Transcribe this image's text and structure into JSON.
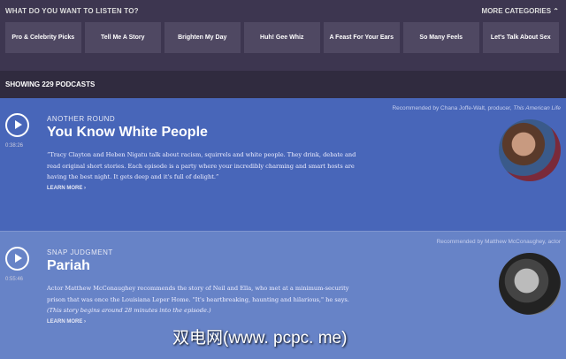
{
  "header": {
    "question": "WHAT DO YOU WANT TO LISTEN TO?",
    "more_categories": "MORE CATEGORIES"
  },
  "categories": [
    "Pro & Celebrity Picks",
    "Tell Me A Story",
    "Brighten My Day",
    "Huh! Gee Whiz",
    "A Feast For Your Ears",
    "So Many Feels",
    "Let's Talk About Sex"
  ],
  "showing": "SHOWING 229 PODCASTS",
  "podcasts": [
    {
      "show": "ANOTHER ROUND",
      "title": "You Know White People",
      "duration": "0:38:26",
      "description": "“Tracy Clayton and Heben Nigatu talk about racism, squirrels and white people. They drink, debate and read original short stories. Each episode is a party where your incredibly charming and smart hosts are having the best night. It gets deep and it's full of delight.”",
      "description_italic": "",
      "learn_more": "LEARN MORE",
      "recommended": "Recommended by Chana Joffe-Walt, producer, ",
      "recommended_italic": "This American Life"
    },
    {
      "show": "SNAP JUDGMENT",
      "title": "Pariah",
      "duration": "0:55:46",
      "description": "Actor Matthew McConaughey recommends the story of Neil and Ella, who met at a minimum-security prison that was once the Louisiana Leper Home. \"It's heartbreaking, haunting and hilarious,\" he says.",
      "description_italic": "(This story begins around 28 minutes into the episode.)",
      "learn_more": "LEARN MORE",
      "recommended": "Recommended by Matthew McConaughey, actor",
      "recommended_italic": ""
    }
  ],
  "watermark": "双电网(www. pcpc. me)"
}
